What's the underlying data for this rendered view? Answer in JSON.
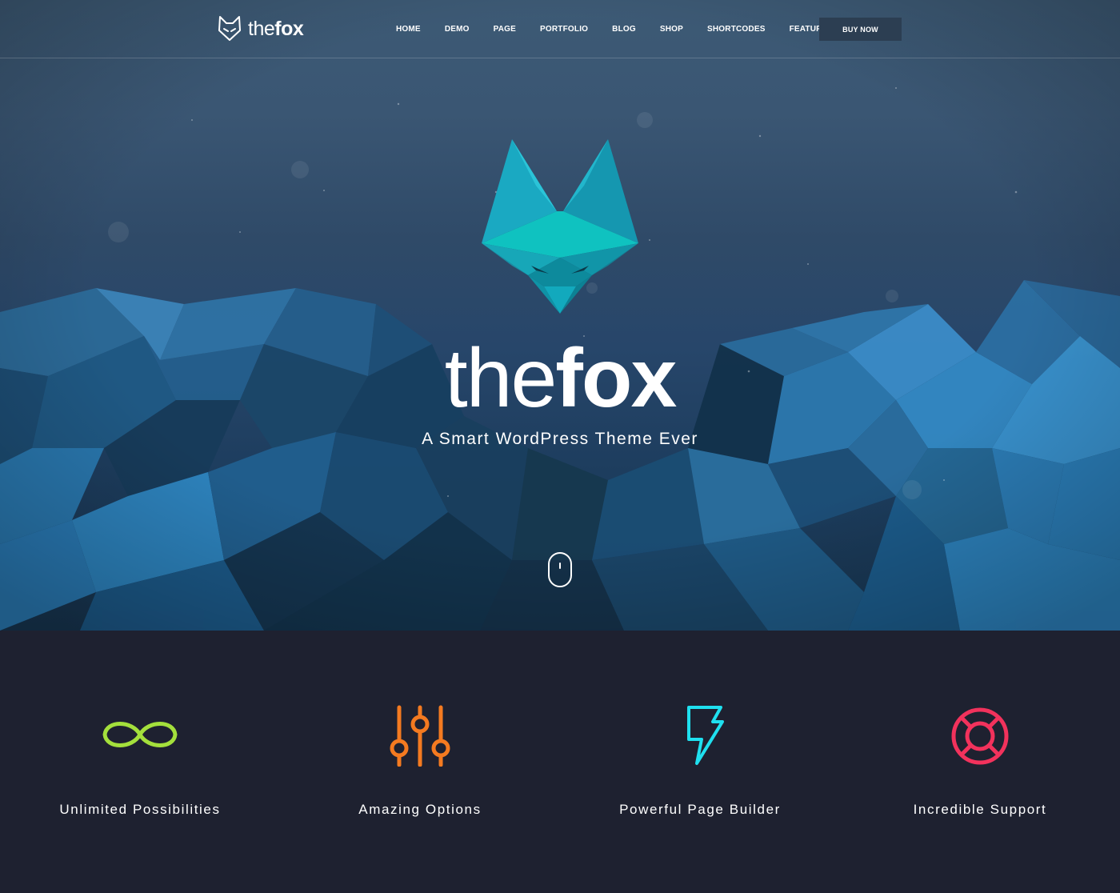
{
  "header": {
    "logo_text_light": "the",
    "logo_text_bold": "fox",
    "nav": [
      "HOME",
      "DEMO",
      "PAGE",
      "PORTFOLIO",
      "BLOG",
      "SHOP",
      "SHORTCODES",
      "FEATURES"
    ],
    "buy_label": "BUY NOW"
  },
  "hero": {
    "title_light": "the",
    "title_bold": "fox",
    "tagline": "A Smart WordPress Theme Ever"
  },
  "features": [
    {
      "label": "Unlimited Possibilities",
      "icon": "infinity-icon",
      "color": "#a4e03c"
    },
    {
      "label": "Amazing Options",
      "icon": "sliders-icon",
      "color": "#f47a20"
    },
    {
      "label": "Powerful Page Builder",
      "icon": "lightning-icon",
      "color": "#1fe0ef"
    },
    {
      "label": "Incredible Support",
      "icon": "lifebuoy-icon",
      "color": "#f2325c"
    }
  ],
  "colors": {
    "hero_top": "#3d5a75",
    "hero_bottom": "#173550",
    "features_bg": "#1e2130",
    "emblem": "#19b8c7"
  }
}
